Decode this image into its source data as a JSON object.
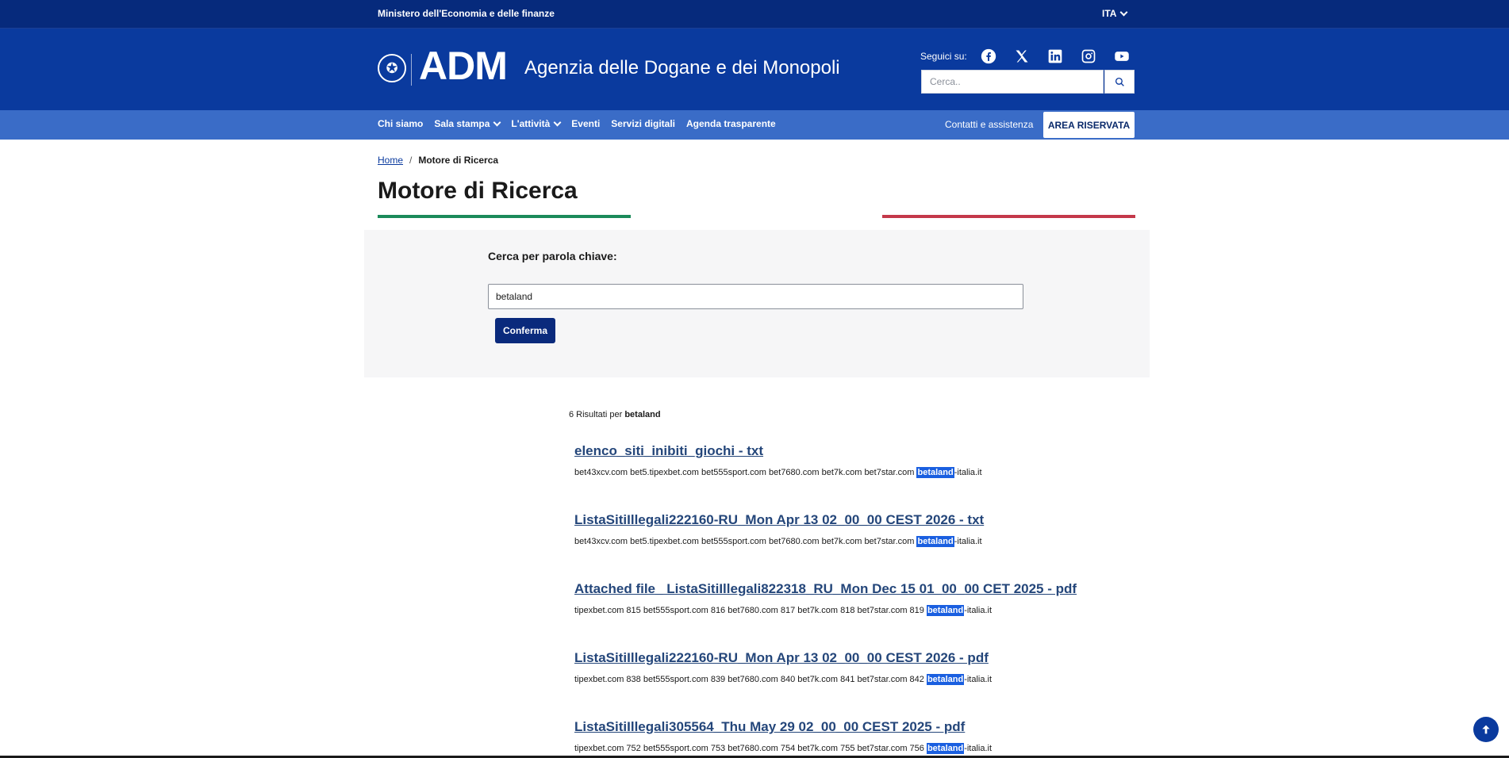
{
  "topbar": {
    "ministry": "Ministero dell'Economia e delle finanze",
    "language": "ITA"
  },
  "header": {
    "logo_text": "ADM",
    "agency_name": "Agenzia delle Dogane e dei Monopoli",
    "follow_label": "Seguici su:",
    "social_icons": [
      "facebook-icon",
      "x-icon",
      "linkedin-icon",
      "instagram-icon",
      "youtube-icon"
    ],
    "search_placeholder": "Cerca.."
  },
  "nav": {
    "items": [
      {
        "label": "Chi siamo",
        "dropdown": false
      },
      {
        "label": "Sala stampa",
        "dropdown": true
      },
      {
        "label": "L'attività",
        "dropdown": true
      },
      {
        "label": "Eventi",
        "dropdown": false
      },
      {
        "label": "Servizi digitali",
        "dropdown": false
      },
      {
        "label": "Agenda trasparente",
        "dropdown": false
      }
    ],
    "contacts": "Contatti e assistenza",
    "reserved_area": "AREA RISERVATA"
  },
  "breadcrumb": {
    "home": "Home",
    "separator": "/",
    "current": "Motore di Ricerca"
  },
  "page": {
    "title": "Motore di Ricerca"
  },
  "search_panel": {
    "label": "Cerca per parola chiave:",
    "value": "betaland",
    "confirm": "Conferma"
  },
  "results": {
    "count_prefix": "6 Risultati per",
    "query": "betaland",
    "items": [
      {
        "title": "elenco_siti_inibiti_giochi - txt",
        "snippet_before": "bet43xcv.com bet5.tipexbet.com bet555sport.com bet7680.com bet7k.com bet7star.com ",
        "highlight": "betaland",
        "snippet_after": "-italia.it"
      },
      {
        "title": "ListaSitiIllegali222160-RU_Mon Apr 13 02_00_00 CEST 2026 - txt",
        "snippet_before": "bet43xcv.com bet5.tipexbet.com bet555sport.com bet7680.com bet7k.com bet7star.com ",
        "highlight": "betaland",
        "snippet_after": "-italia.it"
      },
      {
        "title": "Attached file_ ListaSitiIllegali822318_RU_Mon Dec 15 01_00_00 CET 2025 - pdf",
        "snippet_before": "tipexbet.com 815 bet555sport.com 816 bet7680.com 817 bet7k.com 818 bet7star.com 819 ",
        "highlight": "betaland",
        "snippet_after": "-italia.it"
      },
      {
        "title": "ListaSitiIllegali222160-RU_Mon Apr 13 02_00_00 CEST 2026 - pdf",
        "snippet_before": "tipexbet.com 838 bet555sport.com 839 bet7680.com 840 bet7k.com 841 bet7star.com 842 ",
        "highlight": "betaland",
        "snippet_after": "-italia.it"
      },
      {
        "title": "ListaSitiIllegali305564_Thu May 29 02_00_00 CEST 2025 - pdf",
        "snippet_before": "tipexbet.com 752 bet555sport.com 753 bet7680.com 754 bet7k.com 755 bet7star.com 756 ",
        "highlight": "betaland",
        "snippet_after": "-italia.it"
      }
    ]
  },
  "colors": {
    "topbar": "#062a7c",
    "header": "#0a3a9e",
    "nav": "#3a6cc7",
    "stripe_green": "#1b8a5a",
    "stripe_red": "#c4384a",
    "highlight": "#1a5fe0"
  }
}
